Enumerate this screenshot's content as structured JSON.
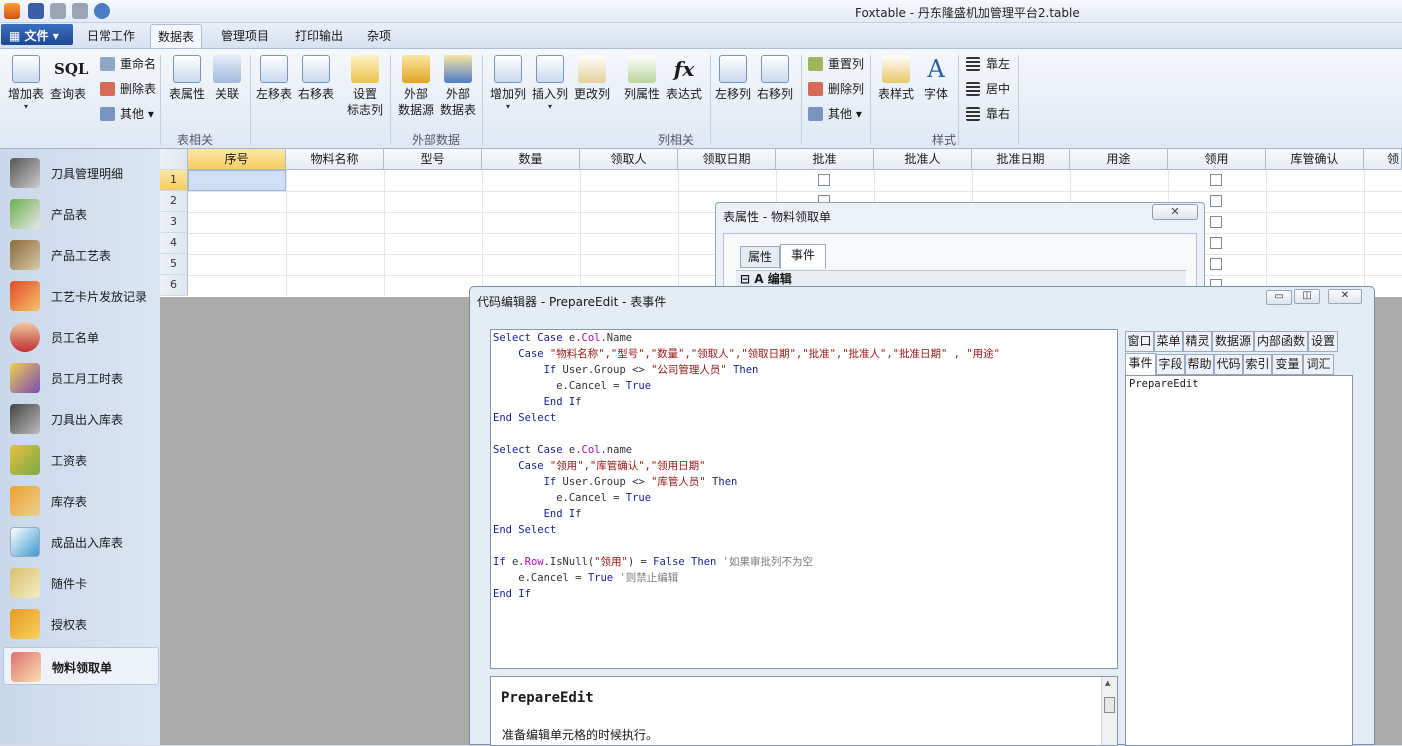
{
  "app": {
    "title": "Foxtable - 丹东隆盛机加管理平台2.table"
  },
  "menu": {
    "file": "文件",
    "tabs": [
      "日常工作",
      "数据表",
      "管理项目",
      "打印输出",
      "杂项"
    ],
    "active": "数据表"
  },
  "ribbon": {
    "buttons": {
      "add_table": "增加表",
      "query_table": "查询表",
      "rename": "重命名",
      "delete_table": "删除表",
      "other1": "其他",
      "table_props": "表属性",
      "relation": "关联",
      "move_left_table": "左移表",
      "move_right_table": "右移表",
      "set_flag_col_1": "设置",
      "set_flag_col_2": "标志列",
      "ext_source_1a": "外部",
      "ext_source_1b": "数据源",
      "ext_table_1a": "外部",
      "ext_table_1b": "数据表",
      "add_col": "增加列",
      "insert_col": "插入列",
      "change_col": "更改列",
      "col_props": "列属性",
      "expression": "表达式",
      "move_left_col": "左移列",
      "move_right_col": "右移列",
      "reset_col": "重置列",
      "delete_col": "删除列",
      "other2": "其他",
      "table_style": "表样式",
      "font": "字体",
      "align_left": "靠左",
      "align_center": "居中",
      "align_right": "靠右",
      "sql_label": "SQL",
      "fx_label": "fx"
    },
    "groups": {
      "table": "表相关",
      "external": "外部数据",
      "column": "列相关",
      "style": "样式"
    }
  },
  "sidebar": {
    "items": [
      "刀具管理明细",
      "产品表",
      "产品工艺表",
      "工艺卡片发放记录",
      "员工名单",
      "员工月工时表",
      "刀具出入库表",
      "工资表",
      "库存表",
      "成品出入库表",
      "随件卡",
      "授权表",
      "物料领取单"
    ],
    "active": "物料领取单"
  },
  "grid": {
    "columns": [
      "序号",
      "物料名称",
      "型号",
      "数量",
      "领取人",
      "领取日期",
      "批准",
      "批准人",
      "批准日期",
      "用途",
      "领用",
      "库管确认",
      "领"
    ],
    "rows": [
      "1",
      "2",
      "3",
      "4",
      "5",
      "6"
    ]
  },
  "props_dialog": {
    "title": "表属性 - 物料领取单",
    "tabs": [
      "属性",
      "事件"
    ],
    "active_tab": "事件",
    "category": "A 编辑",
    "collapse": "⊟"
  },
  "code_dialog": {
    "title": "代码编辑器 - PrepareEdit - 表事件",
    "help_title": "PrepareEdit",
    "help_text": "准备编辑单元格的时候执行。",
    "tabs_row1": [
      "窗口",
      "菜单",
      "精灵",
      "数据源",
      "内部函数",
      "设置"
    ],
    "tabs_row2": [
      "事件",
      "字段",
      "帮助",
      "代码",
      "索引",
      "变量",
      "词汇"
    ],
    "active_tab": "事件",
    "list_items": [
      "PrepareEdit"
    ]
  },
  "icons": {
    "close": "✕",
    "minimize": "▭",
    "restore": "◫",
    "dropdown": "▾",
    "scroll_up": "▲",
    "scroll_down": "▼"
  }
}
